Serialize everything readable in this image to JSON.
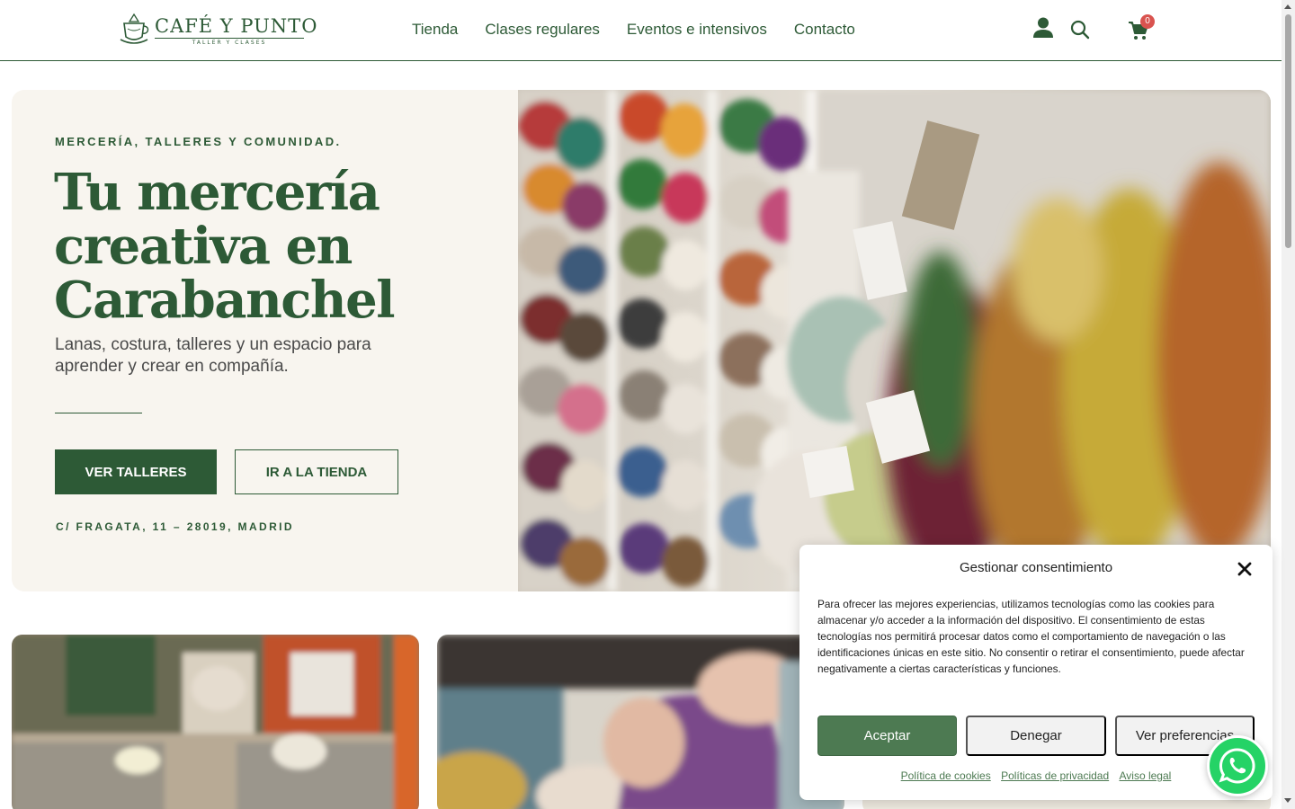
{
  "header": {
    "logo_title": "CAFÉ Y PUNTO",
    "logo_subtitle": "TALLER Y CLASES",
    "nav": [
      {
        "label": "Tienda"
      },
      {
        "label": "Clases regulares"
      },
      {
        "label": "Eventos e intensivos"
      },
      {
        "label": "Contacto"
      }
    ],
    "icons": [
      "user-icon",
      "search-icon",
      "cart-icon"
    ],
    "cart_count": "0"
  },
  "hero": {
    "eyebrow": "MERCERÍA, TALLERES Y COMUNIDAD.",
    "title": "Tu mercería creativa en Carabanchel",
    "subtitle": "Lanas, costura, talleres y un espacio para aprender y crear en compañía.",
    "primary_button": "VER TALLERES",
    "secondary_button": "IR A LA TIENDA",
    "address": "C/ FRAGATA, 11 – 28019, MADRID"
  },
  "consent": {
    "title": "Gestionar consentimiento",
    "text": "Para ofrecer las mejores experiencias, utilizamos tecnologías como las cookies para almacenar y/o acceder a la información del dispositivo. El consentimiento de estas tecnologías nos permitirá procesar datos como el comportamiento de navegación o las identificaciones únicas en este sitio. No consentir o retirar el consentimiento, puede afectar negativamente a ciertas características y funciones.",
    "accept": "Aceptar",
    "deny": "Denegar",
    "preferences": "Ver preferencias",
    "links": [
      {
        "label": "Política de cookies"
      },
      {
        "label": "Políticas de privacidad"
      },
      {
        "label": "Aviso legal"
      }
    ]
  },
  "colors": {
    "brand_green": "#2d5a36",
    "hero_bg": "#f8f5ef",
    "accept_green": "#4d7a52",
    "whatsapp_green": "#25d366",
    "badge_red": "#d9534f"
  }
}
